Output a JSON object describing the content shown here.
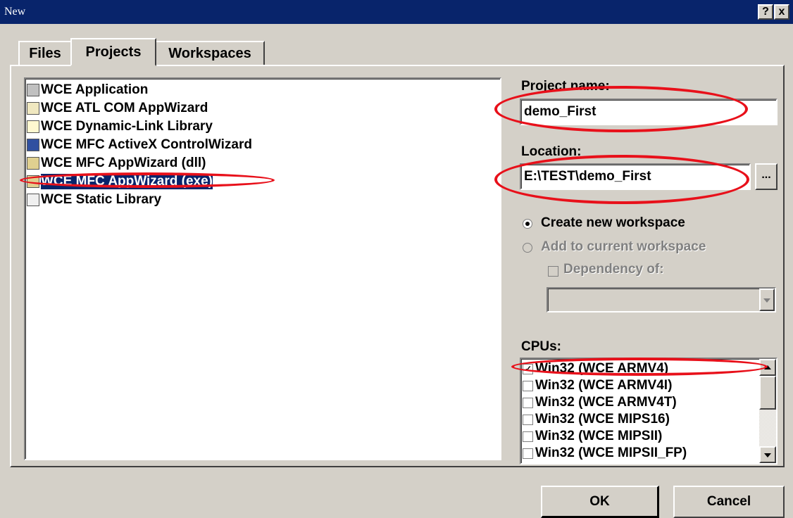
{
  "window": {
    "title": "New",
    "help_label": "?",
    "close_label": "x"
  },
  "tabs": [
    {
      "label": "Files"
    },
    {
      "label": "Projects"
    },
    {
      "label": "Workspaces"
    }
  ],
  "project_types": [
    {
      "label": "WCE Application",
      "icon": "app-icon"
    },
    {
      "label": "WCE ATL COM AppWizard",
      "icon": "atl-wizard-icon"
    },
    {
      "label": "WCE Dynamic-Link Library",
      "icon": "dll-icon"
    },
    {
      "label": "WCE MFC ActiveX ControlWizard",
      "icon": "activex-icon"
    },
    {
      "label": "WCE MFC AppWizard (dll)",
      "icon": "mfc-wizard-icon"
    },
    {
      "label": "WCE MFC AppWizard (exe)",
      "icon": "mfc-wizard-icon",
      "selected": true
    },
    {
      "label": "WCE Static Library",
      "icon": "static-lib-icon"
    }
  ],
  "project_name": {
    "label": "Project name:",
    "value": "demo_First"
  },
  "location": {
    "label": "Location:",
    "value": "E:\\TEST\\demo_First",
    "browse_label": "..."
  },
  "workspace_options": {
    "create_new": {
      "label": "Create new workspace",
      "selected": true
    },
    "add_current": {
      "label": "Add to current workspace",
      "enabled": false
    },
    "dependency": {
      "label": "Dependency of:",
      "enabled": false
    }
  },
  "cpus": {
    "label": "CPUs:",
    "items": [
      {
        "label": "Win32 (WCE ARMV4)",
        "checked": true
      },
      {
        "label": "Win32 (WCE ARMV4I)",
        "checked": false
      },
      {
        "label": "Win32 (WCE ARMV4T)",
        "checked": false
      },
      {
        "label": "Win32 (WCE MIPS16)",
        "checked": false
      },
      {
        "label": "Win32 (WCE MIPSII)",
        "checked": false
      },
      {
        "label": "Win32 (WCE MIPSII_FP)",
        "checked": false
      }
    ]
  },
  "buttons": {
    "ok": "OK",
    "cancel": "Cancel"
  },
  "colors": {
    "title_bar": "#08246b",
    "dialog_bg": "#d4d0c8",
    "annotation": "#e8101a",
    "selection": "#08246b"
  }
}
